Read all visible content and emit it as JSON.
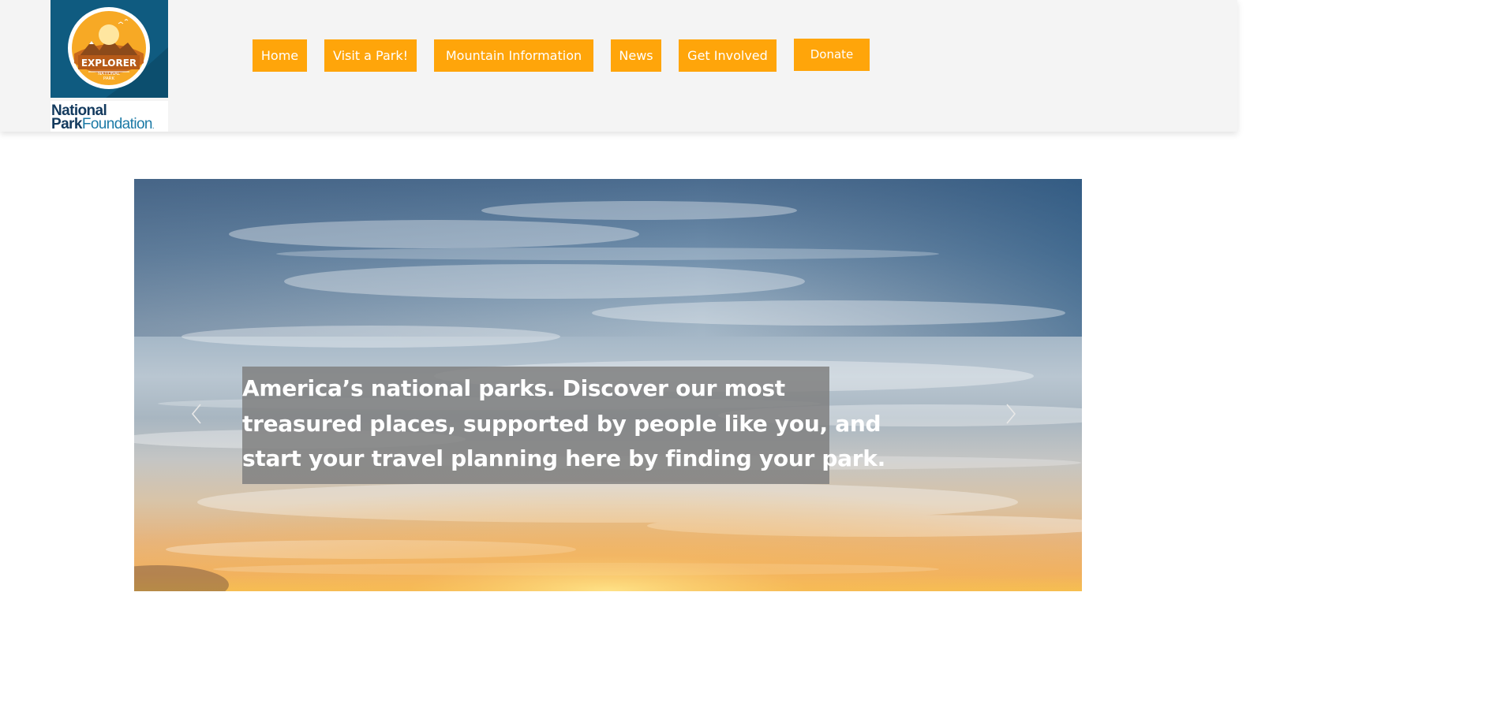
{
  "header": {
    "logo": {
      "badge_text": "EXPLORER",
      "badge_subtext_1": "NATIONAL",
      "badge_subtext_2": "PARK",
      "org_line1": "National",
      "org_line2_bold": "Park",
      "org_line2_light": "Foundation",
      "org_dot": "."
    },
    "nav": [
      {
        "label": "Home"
      },
      {
        "label": "Visit a Park!"
      },
      {
        "label": "Mountain Information"
      },
      {
        "label": "News"
      },
      {
        "label": "Get Involved"
      }
    ],
    "donate_label": "Donate"
  },
  "hero": {
    "caption_lines": [
      "America’s national parks. Discover our most",
      "treasured places, supported by people like you, and",
      "start your travel planning here by finding your park."
    ],
    "prev_icon": "chevron-left-icon",
    "next_icon": "chevron-right-icon"
  },
  "colors": {
    "accent": "#ffa50a",
    "header_bg": "#f4f4f4",
    "logo_blue": "#0f5b80",
    "text_navy": "#133a5e"
  }
}
